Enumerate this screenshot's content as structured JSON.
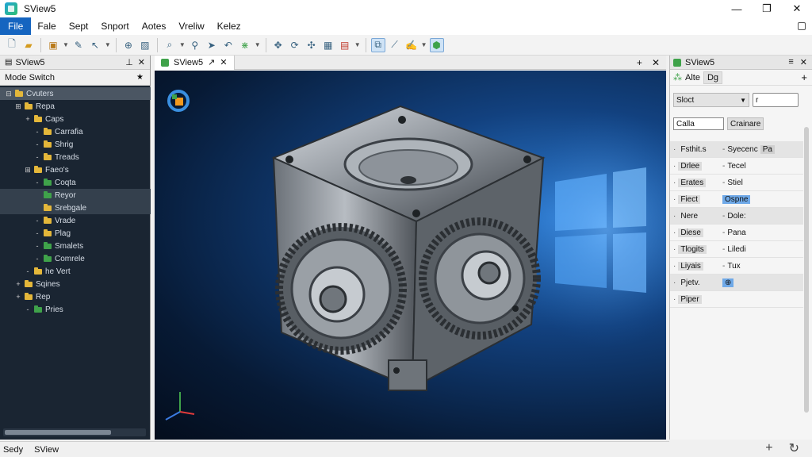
{
  "app": {
    "title": "SView5"
  },
  "window_controls": {
    "minimize": "—",
    "maximize": "❐",
    "close": "✕"
  },
  "menu": [
    "File",
    "Fale",
    "Sept",
    "Snport",
    "Aotes",
    "Vreliw",
    "Kelez"
  ],
  "left_panel": {
    "tab": "SView5",
    "header": "Mode Switch",
    "tree": [
      {
        "label": "Cvuters",
        "level": 0,
        "exp": "⊟",
        "color": "yellow",
        "state": "sel"
      },
      {
        "label": "Repa",
        "level": 1,
        "exp": "⊞",
        "color": "yellow",
        "state": ""
      },
      {
        "label": "Caps",
        "level": 2,
        "exp": "+",
        "color": "yellow",
        "state": ""
      },
      {
        "label": "Carrafia",
        "level": 3,
        "exp": "-",
        "color": "yellow",
        "state": ""
      },
      {
        "label": "Shrig",
        "level": 3,
        "exp": "-",
        "color": "yellow",
        "state": ""
      },
      {
        "label": "Treads",
        "level": 3,
        "exp": "-",
        "color": "yellow",
        "state": ""
      },
      {
        "label": "Faeo's",
        "level": 2,
        "exp": "⊞",
        "color": "yellow",
        "state": ""
      },
      {
        "label": "Coqta",
        "level": 3,
        "exp": "-",
        "color": "green",
        "state": ""
      },
      {
        "label": "Reyor",
        "level": 3,
        "exp": "",
        "color": "green",
        "state": "hl"
      },
      {
        "label": "Srebgale",
        "level": 3,
        "exp": "",
        "color": "yellow",
        "state": "hl"
      },
      {
        "label": "Vrade",
        "level": 3,
        "exp": "-",
        "color": "yellow",
        "state": ""
      },
      {
        "label": "Plag",
        "level": 3,
        "exp": "-",
        "color": "yellow",
        "state": ""
      },
      {
        "label": "Smalets",
        "level": 3,
        "exp": "-",
        "color": "green",
        "state": ""
      },
      {
        "label": "Comrele",
        "level": 3,
        "exp": "-",
        "color": "green",
        "state": ""
      },
      {
        "label": "he Vert",
        "level": 2,
        "exp": "-",
        "color": "yellow",
        "state": ""
      },
      {
        "label": "Sqines",
        "level": 1,
        "exp": "+",
        "color": "yellow",
        "state": ""
      },
      {
        "label": "Rep",
        "level": 1,
        "exp": "+",
        "color": "yellow",
        "state": ""
      },
      {
        "label": "Pries",
        "level": 2,
        "exp": "-",
        "color": "green",
        "state": ""
      }
    ]
  },
  "document_tab": {
    "label": "SView5"
  },
  "right_panel": {
    "title": "SView5",
    "sub_label": "Alte",
    "sub_chip": "Dg",
    "select_value": "Sloct",
    "text_value": "r",
    "filter_input": "Calla",
    "filter_button": "Crainare",
    "properties": [
      {
        "key": "Fsthit.s",
        "val": "Syecenc",
        "chip": "Pa",
        "section": true
      },
      {
        "key": "Drlee",
        "val": "Tecel",
        "chip": "",
        "section": false
      },
      {
        "key": "Erates",
        "val": "Stiel",
        "chip": "",
        "section": false
      },
      {
        "key": "Fiect",
        "val": "",
        "chip": "Ospne",
        "section": false,
        "chip_blue": true
      },
      {
        "key": "Nere",
        "val": "Dole:",
        "chip": "",
        "section": true
      },
      {
        "key": "Diese",
        "val": "Pana",
        "chip": "",
        "section": false
      },
      {
        "key": "Tlogits",
        "val": "Liledi",
        "chip": "",
        "section": false
      },
      {
        "key": "Liyais",
        "val": "Tux",
        "chip": "",
        "section": false
      },
      {
        "key": "Pjetv.",
        "val": "",
        "chip": "⊕",
        "section": true,
        "chip_blue": true
      },
      {
        "key": "Piper",
        "val": "",
        "chip": "",
        "section": false
      }
    ]
  },
  "statusbar": {
    "left": "Sedy",
    "right": "SView"
  },
  "colors": {
    "accent": "#1565c0",
    "viewport_bg": "#0b2a55"
  }
}
